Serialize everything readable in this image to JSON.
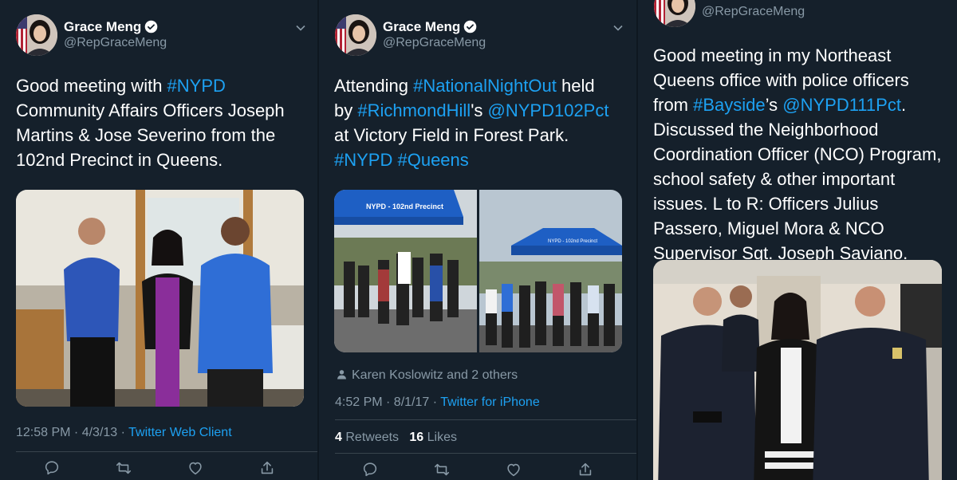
{
  "tweets": [
    {
      "name": "Grace Meng",
      "handle": "@RepGraceMeng",
      "text": [
        {
          "t": "Good meeting with "
        },
        {
          "t": "#NYPD",
          "link": true
        },
        {
          "t": " Community Affairs Officers Joseph Martins & Jose Severino from the 102nd Precinct in Queens."
        }
      ],
      "time": "12:58 PM · 4/3/13 · ",
      "client": "Twitter Web Client"
    },
    {
      "name": "Grace Meng",
      "handle": "@RepGraceMeng",
      "text": [
        {
          "t": "Attending "
        },
        {
          "t": "#NationalNightOut",
          "link": true
        },
        {
          "t": " held by "
        },
        {
          "t": "#RichmondHill",
          "link": true
        },
        {
          "t": "'s "
        },
        {
          "t": "@NYPD102Pct",
          "link": true
        },
        {
          "t": " at Victory Field in Forest Park. "
        },
        {
          "t": "#NYPD",
          "link": true
        },
        {
          "t": " "
        },
        {
          "t": "#Queens",
          "link": true
        }
      ],
      "liked_by": "Karen Koslowitz and 2 others",
      "time": "4:52 PM · 8/1/17 · ",
      "client": "Twitter for iPhone",
      "retweets": "4",
      "retweets_label": "Retweets",
      "likes": "16",
      "likes_label": "Likes",
      "tent_label": "NYPD - 102nd Precinct",
      "tent_label_small": "NYPD - 102nd Precinct"
    },
    {
      "handle": "@RepGraceMeng",
      "text": [
        {
          "t": "Good meeting in my Northeast Queens office with police officers from "
        },
        {
          "t": "#Bayside",
          "link": true
        },
        {
          "t": "’s "
        },
        {
          "t": "@NYPD111Pct",
          "link": true
        },
        {
          "t": ". Discussed the Neighborhood Coordination Officer (NCO) Program, school safety & other important issues. L to R: Officers Julius Passero, Miguel Mora & NCO Supervisor Sgt. Joseph Saviano."
        }
      ]
    }
  ],
  "icons": [
    "reply-icon",
    "retweet-icon",
    "like-icon",
    "share-icon",
    "verified-icon",
    "caret-down-icon",
    "person-icon"
  ],
  "colors": {
    "background": "#15202b",
    "link": "#1da1f2",
    "secondary": "#8899a6"
  }
}
